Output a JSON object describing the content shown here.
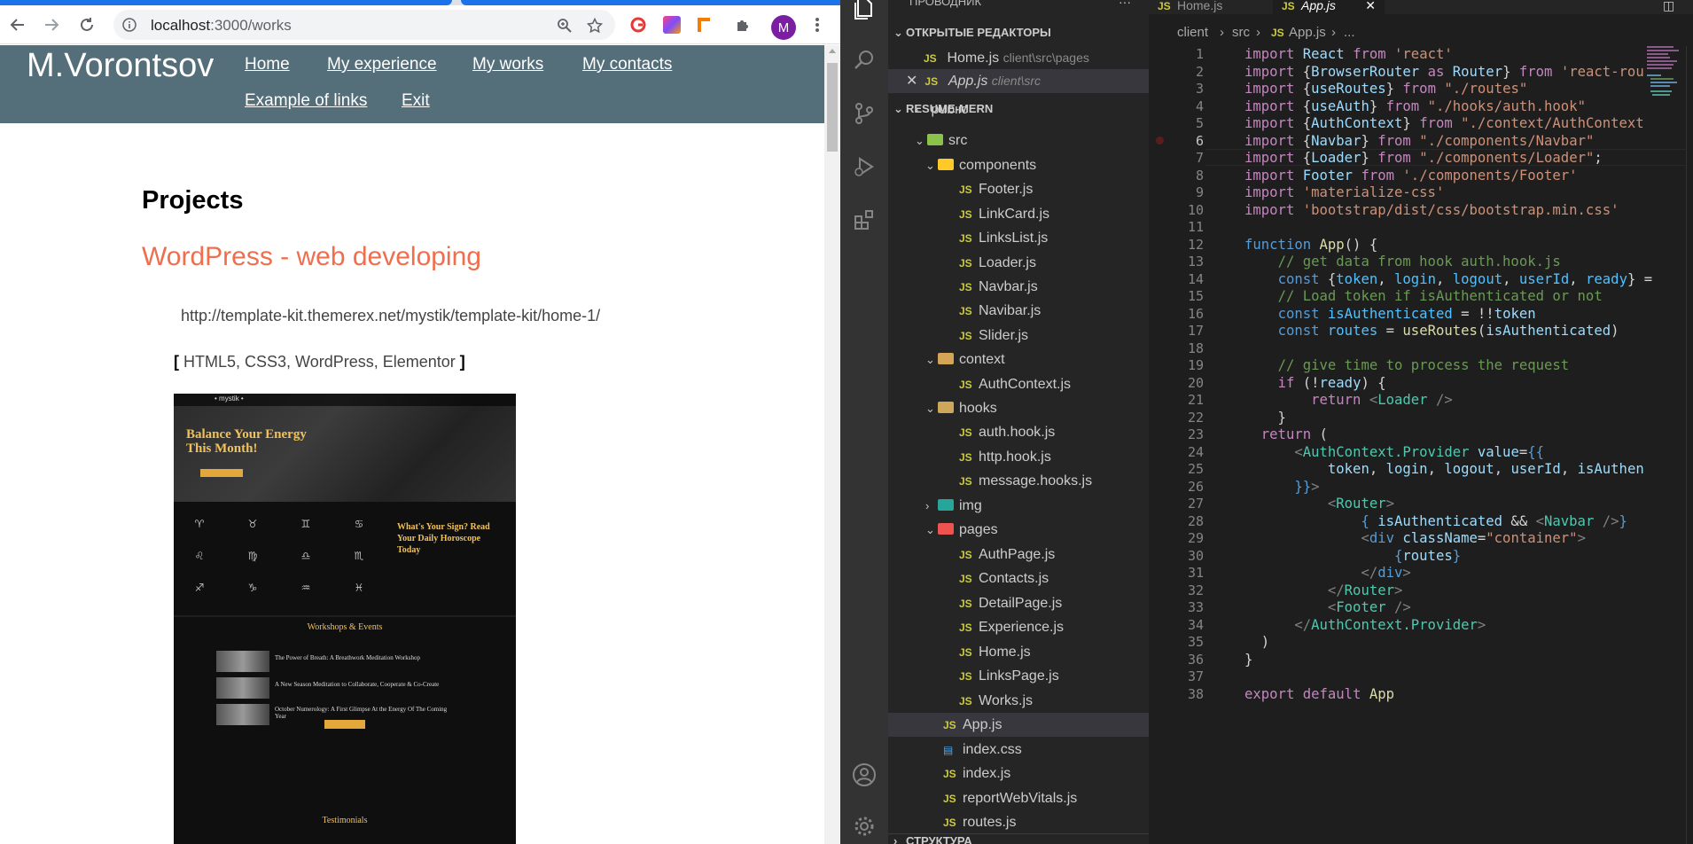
{
  "browser": {
    "url_host": "localhost",
    "url_path": ":3000/works",
    "avatar_letter": "M",
    "icons": [
      "back-icon",
      "forward-icon",
      "reload-icon",
      "info-icon",
      "zoom-icon",
      "star-icon",
      "ext-grammarly-icon",
      "ext-gradient-icon",
      "ext-ruler-icon",
      "puzzle-icon",
      "menu-dots-icon"
    ]
  },
  "site": {
    "brand": "M.Vorontsov",
    "nav": [
      "Home",
      "My experience",
      "My works",
      "My contacts",
      "Example of links",
      "Exit"
    ],
    "page_heading": "Projects",
    "project": {
      "title": "WordPress - web developing",
      "url": "http://template-kit.themerex.net/mystik/template-kit/home-1/",
      "tags_open": "[",
      "tags": " HTML5, CSS3, WordPress, Elementor ",
      "tags_close": "]"
    },
    "screenshot": {
      "logo": "• mystik •",
      "hero_line1": "Balance Your Energy",
      "hero_line2": "This Month!",
      "signs_line1": "What's Your Sign? Read",
      "signs_line2": "Your Daily Horoscope",
      "signs_line3": "Today",
      "workshops": "Workshops & Events",
      "events": [
        "The Power of Breath: A Breathwork Meditation Workshop",
        "A New Season Meditation to Collaborate, Cooperate & Co-Create",
        "October Numerology: A First Glimpse At the Energy Of The Coming Year"
      ],
      "testimonials": "Testimonials"
    }
  },
  "vscode": {
    "explorer_title": "ПРОВОДНИК",
    "open_editors": "ОТКРЫТЫЕ РЕДАКТОРЫ",
    "open_files": [
      {
        "name": "Home.js",
        "path": "client\\src\\pages"
      },
      {
        "name": "App.js",
        "path": "client\\src"
      }
    ],
    "project": "RESUME-MERN",
    "tree_partial": "public",
    "tree": {
      "src": "src",
      "components": "components",
      "components_files": [
        "Footer.js",
        "LinkCard.js",
        "LinksList.js",
        "Loader.js",
        "Navbar.js",
        "Navibar.js",
        "Slider.js"
      ],
      "context": "context",
      "context_files": [
        "AuthContext.js"
      ],
      "hooks": "hooks",
      "hooks_files": [
        "auth.hook.js",
        "http.hook.js",
        "message.hooks.js"
      ],
      "img": "img",
      "pages": "pages",
      "pages_files": [
        "AuthPage.js",
        "Contacts.js",
        "DetailPage.js",
        "Experience.js",
        "Home.js",
        "LinksPage.js",
        "Works.js"
      ],
      "root_files": [
        "App.js",
        "index.css",
        "index.js",
        "reportWebVitals.js",
        "routes.js"
      ]
    },
    "structure": "СТРУКТУРА",
    "tabs": [
      "Home.js",
      "App.js"
    ],
    "breadcrumb": [
      "client",
      "src",
      "App.js",
      "..."
    ],
    "current_line": 6,
    "colors": {
      "keyword": "#c586c0",
      "string": "#ce9178",
      "comment": "#6a9955",
      "variable": "#9cdcfe",
      "tag": "#4ec9b0"
    }
  }
}
